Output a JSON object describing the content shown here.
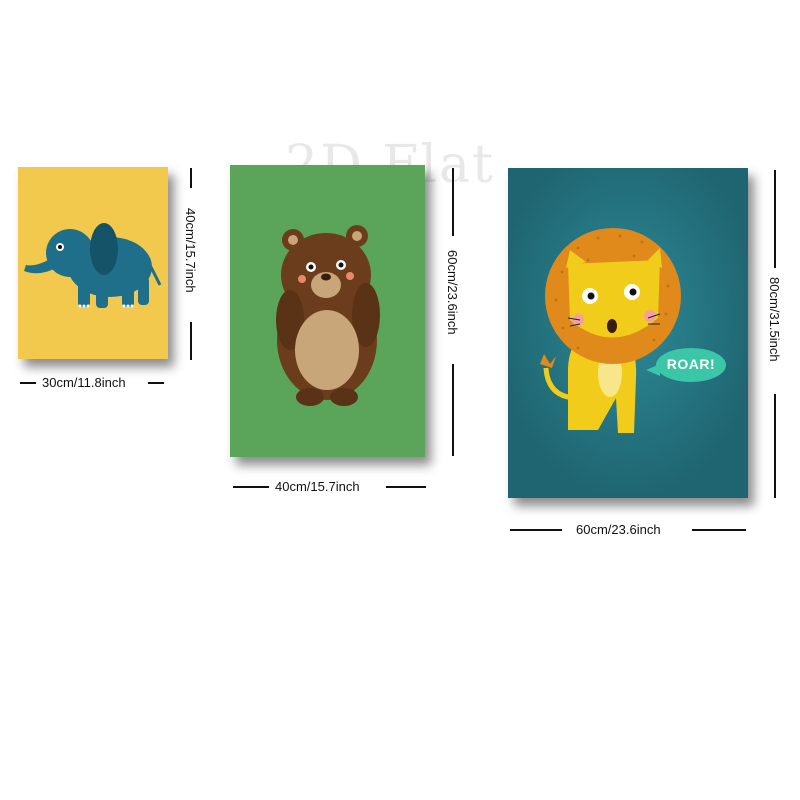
{
  "watermark": "2D Flat",
  "posters": [
    {
      "name": "elephant",
      "bg": "#f2c94c",
      "width_label": "30cm/11.8inch",
      "height_label": "40cm/15.7inch"
    },
    {
      "name": "bear",
      "bg": "#5aa55a",
      "width_label": "40cm/15.7inch",
      "height_label": "60cm/23.6inch"
    },
    {
      "name": "lion",
      "bg": "#23707d",
      "width_label": "60cm/23.6inch",
      "height_label": "80cm/31.5inch",
      "speech": "ROAR!"
    }
  ]
}
